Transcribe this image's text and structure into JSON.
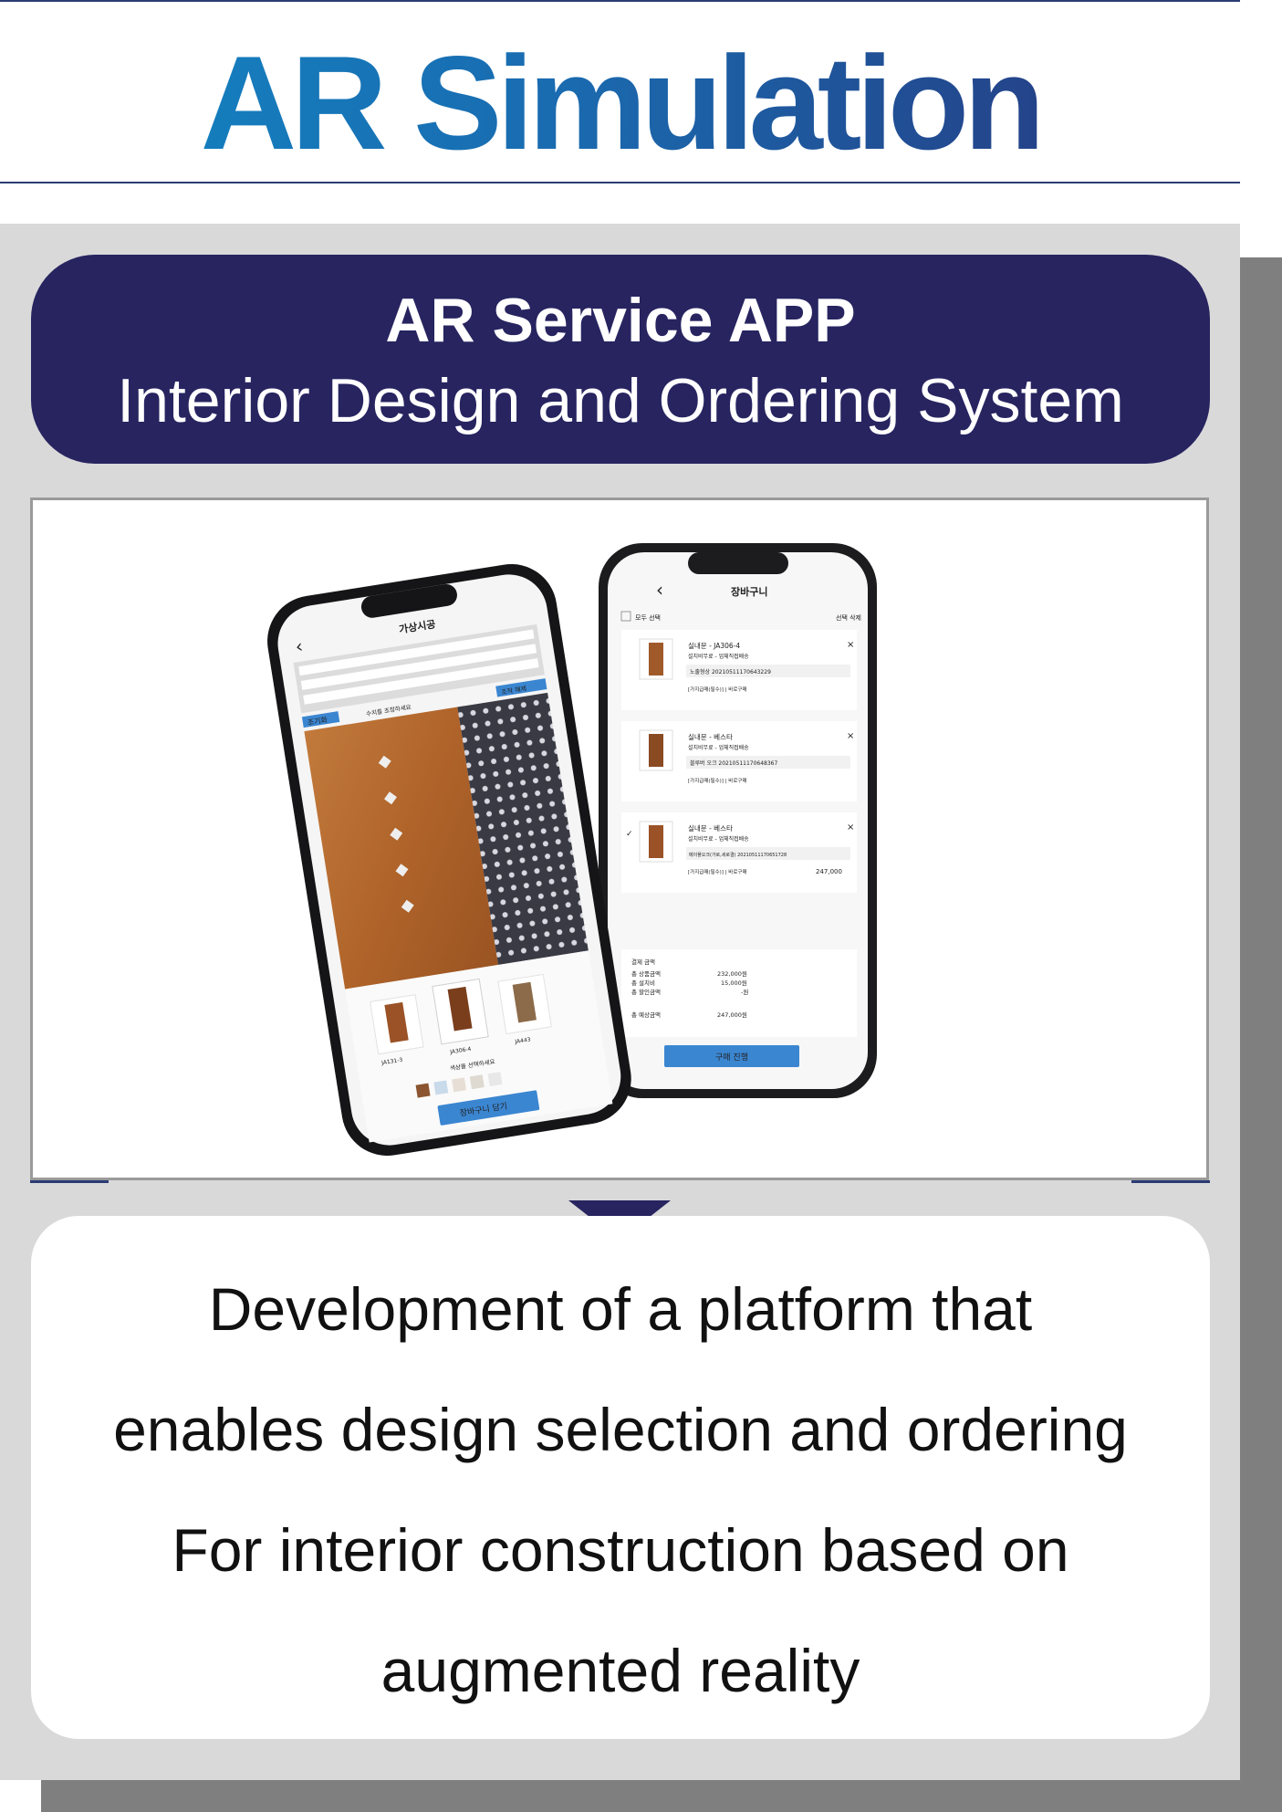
{
  "header": {
    "title": "AR Simulation"
  },
  "banner": {
    "title": "AR Service APP",
    "subtitle": "Interior Design and Ordering System"
  },
  "phone_left": {
    "screen_title": "가상시공",
    "reset_button": "조기화",
    "adjust_label": "수치를 조정하세요",
    "control_button": "조작 해제",
    "door_codes": [
      "JA131-3",
      "JA306-4",
      "JA443"
    ],
    "color_prompt": "색상을 선택하세요",
    "cart_button": "장바구니 담기"
  },
  "phone_right": {
    "screen_title": "장바구니",
    "select_all": "모두 선택",
    "delete_selected": "선택 삭제",
    "items": [
      {
        "name": "실내문 - JA306-4",
        "sub": "설치비무료 - 업체직접배송",
        "option": "노출형상 20210511170643229",
        "tag": "[가지급매(필수)] | 바로구매"
      },
      {
        "name": "실내문 - 베스타",
        "sub": "설치비무료 - 업체직접배송",
        "option": "블루버 오크 20210511170648367",
        "tag": "[가지급매(필수)] | 바로구매"
      },
      {
        "name": "실내문 - 베스타",
        "sub": "설치비무료 - 업체직접배송",
        "option": "메이플오크(가로,세로결) 20210511170651728",
        "tag": "[가지급매(필수)] | 바로구매",
        "price": "247,000"
      }
    ],
    "summary_title": "결제 금액",
    "summary": [
      {
        "label": "총 상품금액",
        "value": "232,000원"
      },
      {
        "label": "총 설치비",
        "value": "15,000원"
      },
      {
        "label": "총 할인금액",
        "value": "-원"
      },
      {
        "label": "총 예상금액",
        "value": "247,000원"
      }
    ],
    "purchase_button": "구매 진행"
  },
  "description": {
    "lines": [
      "Development of a platform that",
      "enables design selection and ordering",
      "For interior construction based on",
      "augmented reality"
    ]
  },
  "colors": {
    "navy": "#272460",
    "brand_blue": "#1287c4",
    "panel_gray": "#d9d9d9"
  }
}
